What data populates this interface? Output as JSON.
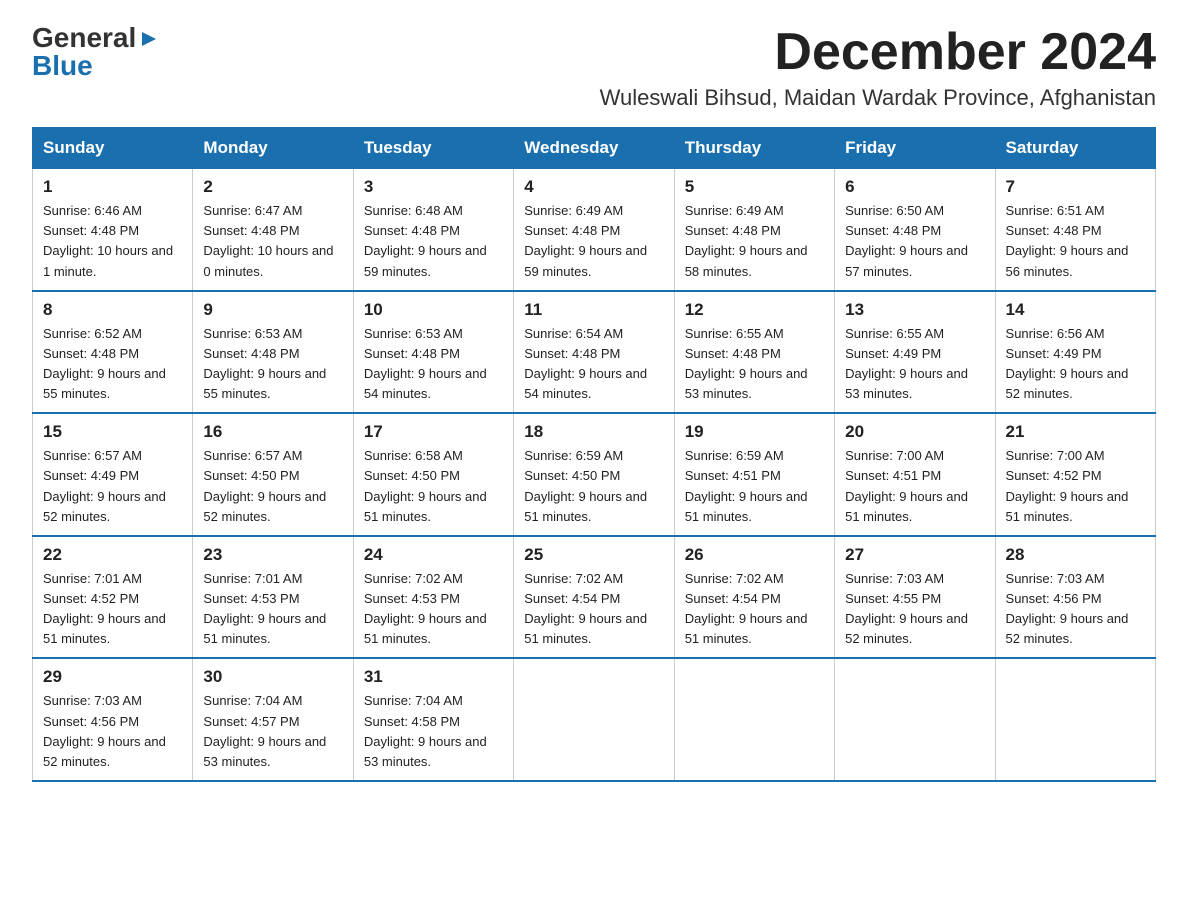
{
  "logo": {
    "general": "General",
    "blue": "Blue",
    "arrow": "▶"
  },
  "title": "December 2024",
  "location": "Wuleswali Bihsud, Maidan Wardak Province, Afghanistan",
  "days_of_week": [
    "Sunday",
    "Monday",
    "Tuesday",
    "Wednesday",
    "Thursday",
    "Friday",
    "Saturday"
  ],
  "weeks": [
    [
      {
        "day": "1",
        "sunrise": "6:46 AM",
        "sunset": "4:48 PM",
        "daylight": "10 hours and 1 minute."
      },
      {
        "day": "2",
        "sunrise": "6:47 AM",
        "sunset": "4:48 PM",
        "daylight": "10 hours and 0 minutes."
      },
      {
        "day": "3",
        "sunrise": "6:48 AM",
        "sunset": "4:48 PM",
        "daylight": "9 hours and 59 minutes."
      },
      {
        "day": "4",
        "sunrise": "6:49 AM",
        "sunset": "4:48 PM",
        "daylight": "9 hours and 59 minutes."
      },
      {
        "day": "5",
        "sunrise": "6:49 AM",
        "sunset": "4:48 PM",
        "daylight": "9 hours and 58 minutes."
      },
      {
        "day": "6",
        "sunrise": "6:50 AM",
        "sunset": "4:48 PM",
        "daylight": "9 hours and 57 minutes."
      },
      {
        "day": "7",
        "sunrise": "6:51 AM",
        "sunset": "4:48 PM",
        "daylight": "9 hours and 56 minutes."
      }
    ],
    [
      {
        "day": "8",
        "sunrise": "6:52 AM",
        "sunset": "4:48 PM",
        "daylight": "9 hours and 55 minutes."
      },
      {
        "day": "9",
        "sunrise": "6:53 AM",
        "sunset": "4:48 PM",
        "daylight": "9 hours and 55 minutes."
      },
      {
        "day": "10",
        "sunrise": "6:53 AM",
        "sunset": "4:48 PM",
        "daylight": "9 hours and 54 minutes."
      },
      {
        "day": "11",
        "sunrise": "6:54 AM",
        "sunset": "4:48 PM",
        "daylight": "9 hours and 54 minutes."
      },
      {
        "day": "12",
        "sunrise": "6:55 AM",
        "sunset": "4:48 PM",
        "daylight": "9 hours and 53 minutes."
      },
      {
        "day": "13",
        "sunrise": "6:55 AM",
        "sunset": "4:49 PM",
        "daylight": "9 hours and 53 minutes."
      },
      {
        "day": "14",
        "sunrise": "6:56 AM",
        "sunset": "4:49 PM",
        "daylight": "9 hours and 52 minutes."
      }
    ],
    [
      {
        "day": "15",
        "sunrise": "6:57 AM",
        "sunset": "4:49 PM",
        "daylight": "9 hours and 52 minutes."
      },
      {
        "day": "16",
        "sunrise": "6:57 AM",
        "sunset": "4:50 PM",
        "daylight": "9 hours and 52 minutes."
      },
      {
        "day": "17",
        "sunrise": "6:58 AM",
        "sunset": "4:50 PM",
        "daylight": "9 hours and 51 minutes."
      },
      {
        "day": "18",
        "sunrise": "6:59 AM",
        "sunset": "4:50 PM",
        "daylight": "9 hours and 51 minutes."
      },
      {
        "day": "19",
        "sunrise": "6:59 AM",
        "sunset": "4:51 PM",
        "daylight": "9 hours and 51 minutes."
      },
      {
        "day": "20",
        "sunrise": "7:00 AM",
        "sunset": "4:51 PM",
        "daylight": "9 hours and 51 minutes."
      },
      {
        "day": "21",
        "sunrise": "7:00 AM",
        "sunset": "4:52 PM",
        "daylight": "9 hours and 51 minutes."
      }
    ],
    [
      {
        "day": "22",
        "sunrise": "7:01 AM",
        "sunset": "4:52 PM",
        "daylight": "9 hours and 51 minutes."
      },
      {
        "day": "23",
        "sunrise": "7:01 AM",
        "sunset": "4:53 PM",
        "daylight": "9 hours and 51 minutes."
      },
      {
        "day": "24",
        "sunrise": "7:02 AM",
        "sunset": "4:53 PM",
        "daylight": "9 hours and 51 minutes."
      },
      {
        "day": "25",
        "sunrise": "7:02 AM",
        "sunset": "4:54 PM",
        "daylight": "9 hours and 51 minutes."
      },
      {
        "day": "26",
        "sunrise": "7:02 AM",
        "sunset": "4:54 PM",
        "daylight": "9 hours and 51 minutes."
      },
      {
        "day": "27",
        "sunrise": "7:03 AM",
        "sunset": "4:55 PM",
        "daylight": "9 hours and 52 minutes."
      },
      {
        "day": "28",
        "sunrise": "7:03 AM",
        "sunset": "4:56 PM",
        "daylight": "9 hours and 52 minutes."
      }
    ],
    [
      {
        "day": "29",
        "sunrise": "7:03 AM",
        "sunset": "4:56 PM",
        "daylight": "9 hours and 52 minutes."
      },
      {
        "day": "30",
        "sunrise": "7:04 AM",
        "sunset": "4:57 PM",
        "daylight": "9 hours and 53 minutes."
      },
      {
        "day": "31",
        "sunrise": "7:04 AM",
        "sunset": "4:58 PM",
        "daylight": "9 hours and 53 minutes."
      },
      null,
      null,
      null,
      null
    ]
  ],
  "labels": {
    "sunrise": "Sunrise:",
    "sunset": "Sunset:",
    "daylight": "Daylight:"
  }
}
